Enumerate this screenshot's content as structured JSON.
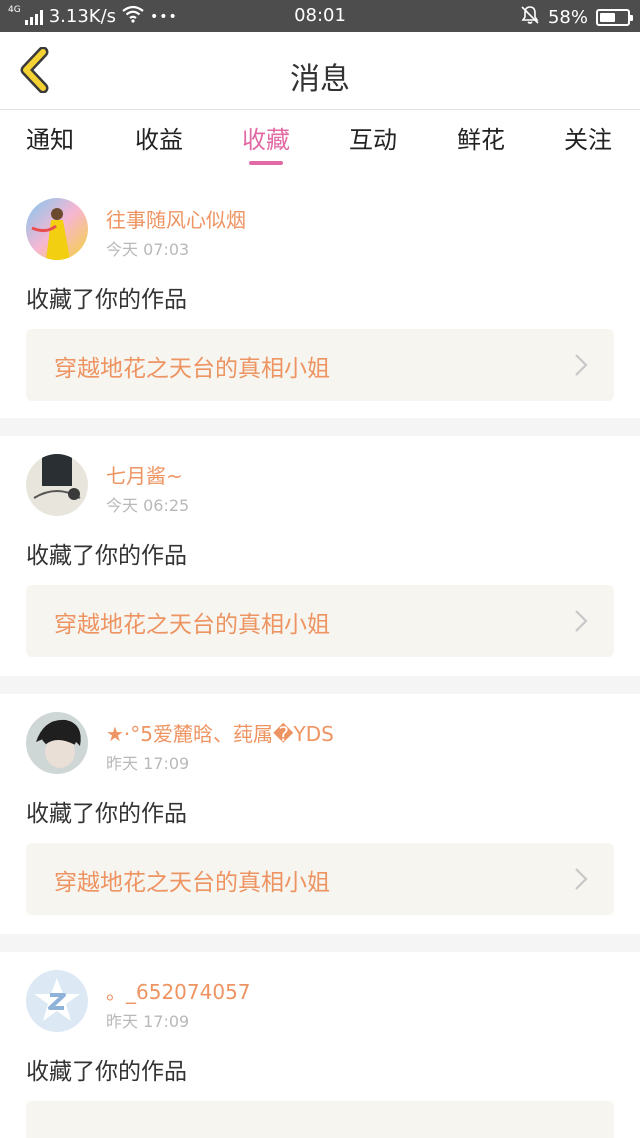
{
  "status_bar": {
    "network_tag": "4G",
    "speed": "3.13K/s",
    "dots": "•••",
    "time": "08:01",
    "battery_pct": "58%",
    "battery_level": 0.58,
    "icons": [
      "signal-icon",
      "wifi-icon",
      "mute-bell-icon",
      "battery-icon"
    ]
  },
  "header": {
    "title": "消息",
    "back_icon": "chevron-left-icon",
    "accent": "#f5d233"
  },
  "tabs": [
    {
      "label": "通知",
      "active": false
    },
    {
      "label": "收益",
      "active": false
    },
    {
      "label": "收藏",
      "active": true
    },
    {
      "label": "互动",
      "active": false
    },
    {
      "label": "鲜花",
      "active": false
    },
    {
      "label": "关注",
      "active": false
    }
  ],
  "colors": {
    "tab_active": "#e26aa4",
    "username": "#ee9462",
    "link_bg": "#f6f5f0"
  },
  "feed": [
    {
      "user": "往事随风心似烟",
      "time": "今天 07:03",
      "action": "收藏了你的作品",
      "work": "穿越地花之天台的真相小姐"
    },
    {
      "user": "七月酱~",
      "time": "今天 06:25",
      "action": "收藏了你的作品",
      "work": "穿越地花之天台的真相小姐"
    },
    {
      "user": "★·°5爱麓晗、莼属�YDS",
      "time": "昨天 17:09",
      "action": "收藏了你的作品",
      "work": "穿越地花之天台的真相小姐"
    },
    {
      "user": "。_652074057",
      "time": "昨天 17:09",
      "action": "收藏了你的作品",
      "work": ""
    }
  ]
}
